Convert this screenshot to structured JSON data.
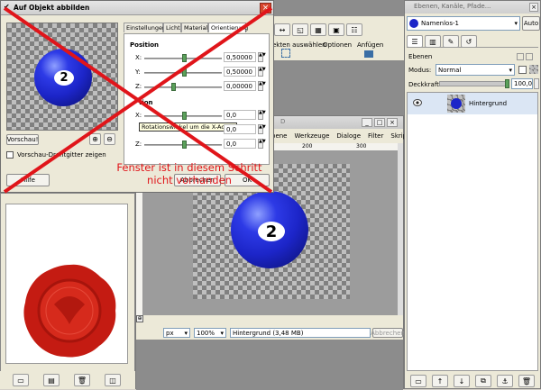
{
  "colors": {
    "accent": "#3a6ea5",
    "cross": "#e0151a",
    "ball": "#1c25c8",
    "seal": "#c41b12"
  },
  "dialog": {
    "title": "Auf Objekt abbilden",
    "tabs": [
      "Einstellungen",
      "Licht",
      "Material",
      "Orientierung"
    ],
    "position_heading": "Position",
    "rotation_heading": "tion",
    "rows": [
      {
        "axis": "X:",
        "value": "0,50000"
      },
      {
        "axis": "Y:",
        "value": "0,50000"
      },
      {
        "axis": "Z:",
        "value": "0,00000"
      }
    ],
    "rot_rows": [
      {
        "axis": "X:",
        "value": "0,0"
      },
      {
        "axis": "Y:",
        "value": "0,0"
      },
      {
        "axis": "Z:",
        "value": "0,0"
      }
    ],
    "tooltip": "Rotationswinkel um die X-Achse",
    "preview_button": "Vorschau!",
    "preview_checkbox": "Vorschau-Drahtgitter zeigen",
    "help_button": "Hilfe",
    "cancel_button": "Abbrechen",
    "ok_button": "OK",
    "ball_number": "2"
  },
  "overlay_note": "Fenster ist in diesem Schritt\nnicht vorhanden",
  "gimp_toolbar": {
    "labels": [
      "ekten auswählen",
      "Optionen",
      "Anfügen"
    ]
  },
  "image_window": {
    "title_suffix": "D",
    "menu": [
      "bene",
      "Werkzeuge",
      "Dialoge",
      "Filter",
      "Skript-Fu"
    ],
    "ruler_marks": [
      "200",
      "300"
    ],
    "unit": "px",
    "zoom": "100%",
    "status": "Hintergrund (3,48 MB)",
    "cancel": "Abbrechen",
    "ball_number": "2"
  },
  "layers_panel": {
    "title": "Ebenen, Kanäle, Pfade...",
    "image_select": "Namenlos-1",
    "auto": "Auto",
    "section": "Ebenen",
    "mode_label": "Modus:",
    "mode_value": "Normal",
    "opacity_label": "Deckkraft:",
    "opacity_value": "100,0",
    "layer_name": "Hintergrund"
  }
}
